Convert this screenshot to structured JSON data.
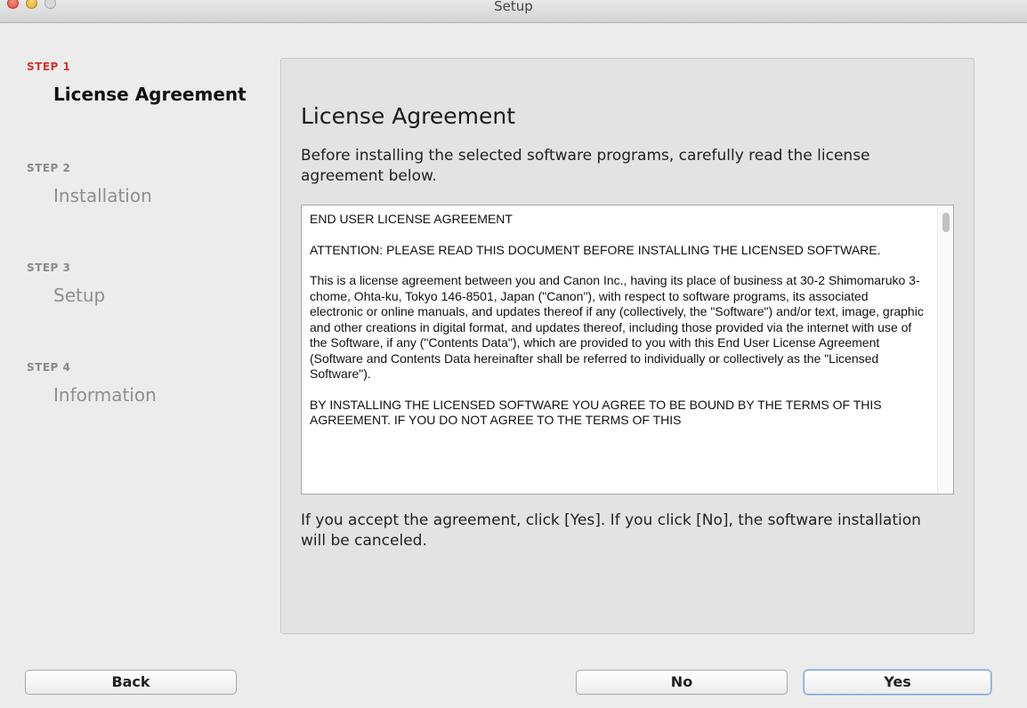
{
  "window": {
    "title": "Setup"
  },
  "sidebar": {
    "steps": [
      {
        "step": "STEP 1",
        "title": "License Agreement"
      },
      {
        "step": "STEP 2",
        "title": "Installation"
      },
      {
        "step": "STEP 3",
        "title": "Setup"
      },
      {
        "step": "STEP 4",
        "title": "Information"
      }
    ]
  },
  "main": {
    "heading": "License Agreement",
    "intro": "Before installing the selected software programs, carefully read the license agreement below.",
    "license_paragraphs": [
      "END USER LICENSE AGREEMENT",
      "ATTENTION: PLEASE READ THIS DOCUMENT BEFORE INSTALLING THE LICENSED SOFTWARE.",
      "This is a license agreement between you and Canon Inc., having its place of business at 30-2 Shimomaruko 3-chome, Ohta-ku, Tokyo 146-8501, Japan (\"Canon\"), with respect to software programs, its associated electronic or online manuals, and updates thereof if any (collectively, the \"Software\") and/or text, image, graphic and other creations in digital format, and updates thereof, including those provided via the internet with use of the Software, if any (\"Contents Data\"), which are provided to you with this End User License Agreement (Software and Contents Data hereinafter shall be referred to individually or collectively as the \"Licensed Software\").",
      "BY INSTALLING THE LICENSED SOFTWARE YOU AGREE TO BE BOUND BY THE TERMS OF THIS AGREEMENT. IF YOU DO NOT AGREE TO THE TERMS OF THIS"
    ],
    "footer": "If you accept the agreement, click [Yes]. If you click [No], the software installation will be canceled."
  },
  "buttons": {
    "back": "Back",
    "no": "No",
    "yes": "Yes"
  },
  "colors": {
    "active_step": "#d9352b",
    "default_button_focus": "#7fa7d8"
  }
}
